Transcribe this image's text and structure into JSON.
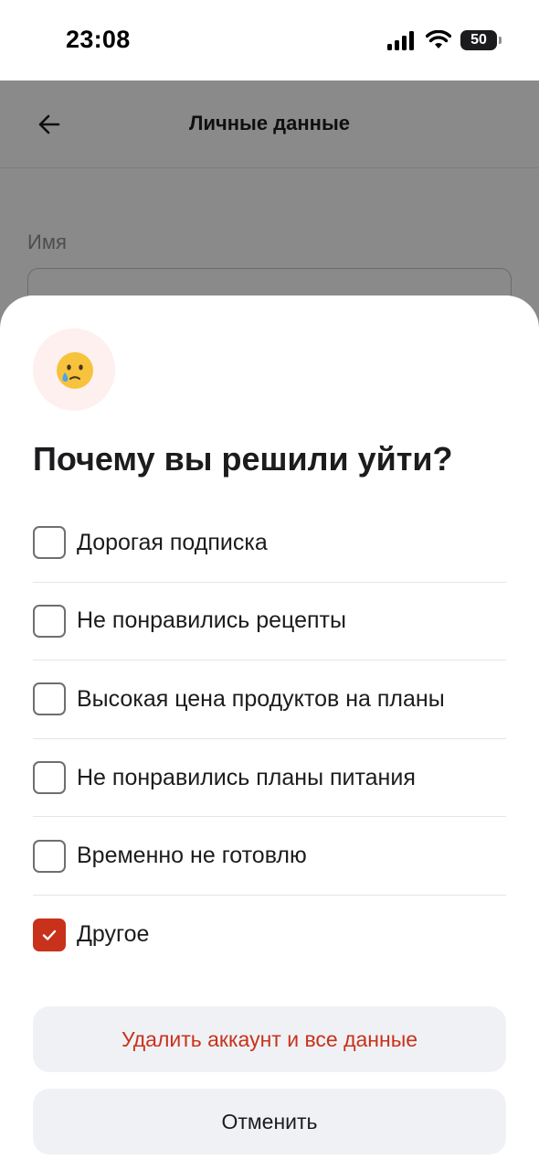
{
  "status_bar": {
    "time": "23:08",
    "battery": "50"
  },
  "page": {
    "title": "Личные данные",
    "field_label": "Имя"
  },
  "sheet": {
    "emoji": "😢",
    "title": "Почему вы решили уйти?",
    "options": [
      {
        "label": "Дорогая подписка",
        "checked": false
      },
      {
        "label": "Не понравились рецепты",
        "checked": false
      },
      {
        "label": "Высокая цена продуктов на планы",
        "checked": false
      },
      {
        "label": "Не понравились планы питания",
        "checked": false
      },
      {
        "label": "Временно не готовлю",
        "checked": false
      },
      {
        "label": "Другое",
        "checked": true
      }
    ],
    "delete_label": "Удалить аккаунт и все данные",
    "cancel_label": "Отменить"
  },
  "colors": {
    "accent": "#c8321b",
    "button_bg": "#f0f1f5",
    "badge_bg": "#fdf0ee"
  }
}
